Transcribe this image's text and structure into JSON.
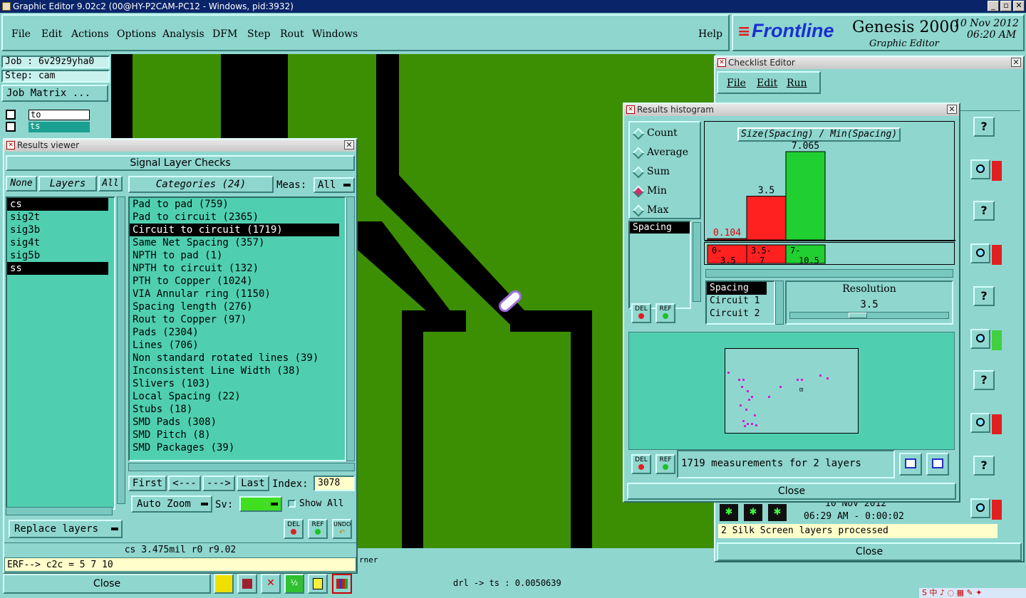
{
  "window": {
    "title": "Graphic Editor 9.02c2 (00@HY-P2CAM-PC12 - Windows, pid:3932)",
    "min": "_",
    "max": "▫",
    "close": "✕"
  },
  "menu": {
    "items": [
      "File",
      "Edit",
      "Actions",
      "Options",
      "Analysis",
      "DFM",
      "Step",
      "Rout",
      "Windows"
    ],
    "help": "Help"
  },
  "brand": {
    "logo": "Frontline",
    "product": "Genesis 2000",
    "sub": "Graphic Editor",
    "date": "10 Nov 2012",
    "time": "06:20 AM"
  },
  "job": {
    "job": "Job : 6v29z9yha0",
    "step": "Step: cam",
    "matrix_btn": "Job Matrix ...",
    "layers": [
      "to",
      "ts"
    ]
  },
  "results_viewer": {
    "title": "Results viewer",
    "header": "Signal Layer Checks",
    "none": "None",
    "layers": "Layers",
    "all": "All",
    "categories_btn": "Categories (24)",
    "meas_label": "Meas:",
    "meas_value": "All",
    "layer_list": [
      "cs",
      "sig2t",
      "sig3b",
      "sig4t",
      "sig5b",
      "ss"
    ],
    "category_list": [
      "Pad to pad (759)",
      "Pad to circuit (2365)",
      "Circuit to circuit (1719)",
      "Same Net Spacing (357)",
      "NPTH to pad (1)",
      "NPTH to circuit (132)",
      "PTH to Copper (1024)",
      "VIA Annular ring (1150)",
      "Spacing length (276)",
      "Rout to Copper (97)",
      "Pads (2304)",
      "Lines (706)",
      "Non standard rotated lines (39)",
      "Inconsistent Line Width (38)",
      "Slivers (103)",
      "Local Spacing (22)",
      "Stubs (18)",
      "SMD Pads (308)",
      "SMD Pitch (8)",
      "SMD Packages (39)"
    ],
    "first": "First",
    "prev": "<---",
    "next": "--->",
    "last": "Last",
    "index_label": "Index:",
    "index_value": "3078",
    "auto_zoom": "Auto Zoom",
    "sv": "Sv:",
    "show_all": "Show All",
    "replace_layers": "Replace layers",
    "del": "DEL",
    "ref": "REF",
    "undo": "UNDO",
    "status": "cs 3.475mil  r0  r9.02",
    "erf": "ERF--> c2c = 5 7 10",
    "close": "Close"
  },
  "canvas": {
    "label_corner": "rner",
    "status": "drl -> ts : 0.0050639"
  },
  "histogram": {
    "title": "Results histogram",
    "modes": [
      "Count",
      "Average",
      "Sum",
      "Min",
      "Max"
    ],
    "selected": "Min",
    "chart_title": "Size(Spacing) / Min(Spacing)",
    "measure_list": [
      "Spacing"
    ],
    "bins": [
      {
        "label": "0-3.5",
        "value": 0.104,
        "color": "#ff2020"
      },
      {
        "label": "3.5-7",
        "value": 3.5,
        "color": "#ff2020"
      },
      {
        "label": "7-10.5",
        "value": 7.065,
        "color": "#20d030"
      }
    ],
    "bin_text": [
      "0-\n3.5",
      "3.5-\n7",
      "7-\n10.5"
    ],
    "value_labels": [
      "0.104",
      "3.5",
      "7.065"
    ],
    "props": [
      "Spacing",
      "Circuit 1",
      "Circuit 2"
    ],
    "resolution_label": "Resolution",
    "resolution": "3.5",
    "summary": "1719 measurements for 2 layers",
    "del": "DEL",
    "ref": "REF",
    "close": "Close"
  },
  "checklist": {
    "title": "Checklist Editor",
    "menu": [
      "File",
      "Edit",
      "Run"
    ],
    "date": "10 Nov 2012",
    "time": "06:29 AM - 0:00:02",
    "message": "2 Silk Screen layers processed",
    "close": "Close",
    "help": "?"
  }
}
